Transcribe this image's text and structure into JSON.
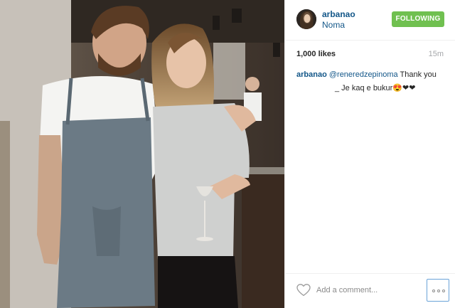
{
  "post": {
    "username": "arbanao",
    "location": "Noma",
    "follow_label": "FOLLOWING",
    "likes": "1,000 likes",
    "time": "15m",
    "caption": {
      "username": "arbanao",
      "mention": "@reneredzepinoma",
      "text_1": " Thank you",
      "text_2": "_ Je kaq e bukur😍❤❤"
    },
    "comment_placeholder": "Add a comment..."
  },
  "icons": {
    "like": "heart-outline-icon",
    "more": "more-options-icon"
  },
  "colors": {
    "link": "#125688",
    "follow_button": "#70c050",
    "more_button_border": "#6aa3d8"
  }
}
